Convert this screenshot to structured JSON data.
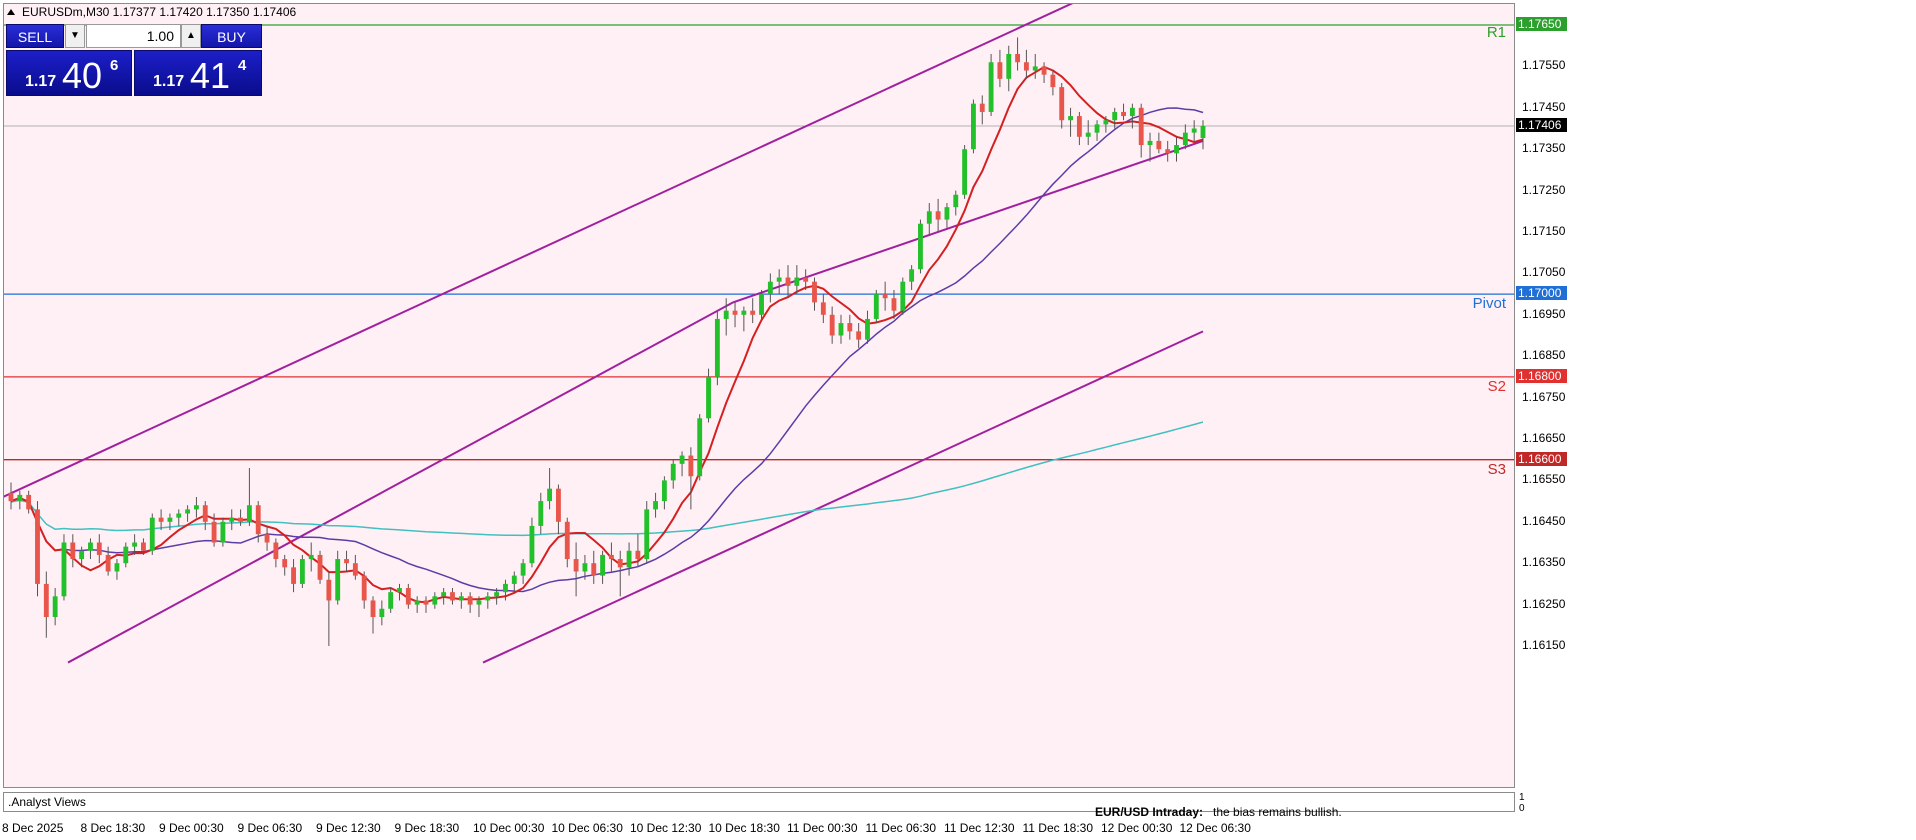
{
  "header": {
    "symbol_info": "EURUSDm,M30  1.17377 1.17420 1.17350 1.17406"
  },
  "trade_panel": {
    "sell_label": "SELL",
    "buy_label": "BUY",
    "lot_value": "1.00",
    "sell_price_small": "1.17",
    "sell_price_big": "40",
    "sell_price_sup": "6",
    "buy_price_small": "1.17",
    "buy_price_big": "41",
    "buy_price_sup": "4"
  },
  "price_axis": {
    "ticks": [
      "1.17550",
      "1.17450",
      "1.17350",
      "1.17250",
      "1.17150",
      "1.17050",
      "1.16950",
      "1.16850",
      "1.16750",
      "1.16650",
      "1.16550",
      "1.16450",
      "1.16350",
      "1.16250",
      "1.16150"
    ],
    "current_price": "1.17406",
    "levels": [
      {
        "name": "R1",
        "value": "1.17650",
        "color": "#2ca02c"
      },
      {
        "name": "Pivot",
        "value": "1.17000",
        "color": "#1f6fd6"
      },
      {
        "name": "S2",
        "value": "1.16800",
        "color": "#e03030"
      },
      {
        "name": "S3",
        "value": "1.16600",
        "color": "#c02828"
      }
    ]
  },
  "time_axis": {
    "labels": [
      "8 Dec 2025",
      "8 Dec 18:30",
      "9 Dec 00:30",
      "9 Dec 06:30",
      "9 Dec 12:30",
      "9 Dec 18:30",
      "10 Dec 00:30",
      "10 Dec 06:30",
      "10 Dec 12:30",
      "10 Dec 18:30",
      "11 Dec 00:30",
      "11 Dec 06:30",
      "11 Dec 12:30",
      "11 Dec 18:30",
      "12 Dec 00:30",
      "12 Dec 06:30"
    ]
  },
  "subwindow": {
    "label": ".Analyst Views",
    "scale_top": "1",
    "scale_bottom": "0"
  },
  "analyst_view": {
    "title": "EUR/USD Intraday:",
    "text": "the bias remains bullish."
  },
  "colors": {
    "background": "#fff0f5",
    "bull_candle": "#22c02a",
    "bear_candle": "#e8554a",
    "channel": "#a020a0",
    "ma_fast": "#d42020",
    "ma_mid": "#5a3ea8",
    "ma_slow": "#40c0c0"
  },
  "chart_data": {
    "type": "candlestick",
    "symbol": "EURUSDm",
    "timeframe": "M30",
    "ylim": [
      1.1611,
      1.1771
    ],
    "last": {
      "open": 1.17377,
      "high": 1.1742,
      "low": 1.1735,
      "close": 1.17406
    },
    "candles": [
      [
        1.1652,
        1.16545,
        1.1648,
        1.165
      ],
      [
        1.165,
        1.16525,
        1.1648,
        1.16515
      ],
      [
        1.16515,
        1.16525,
        1.1647,
        1.1648
      ],
      [
        1.1648,
        1.165,
        1.1627,
        1.163
      ],
      [
        1.163,
        1.1633,
        1.1617,
        1.1622
      ],
      [
        1.1622,
        1.1629,
        1.162,
        1.1627
      ],
      [
        1.1627,
        1.1642,
        1.1626,
        1.164
      ],
      [
        1.164,
        1.1642,
        1.1634,
        1.1636
      ],
      [
        1.1636,
        1.1639,
        1.1634,
        1.1638
      ],
      [
        1.1638,
        1.1641,
        1.1636,
        1.164
      ],
      [
        1.164,
        1.1642,
        1.1635,
        1.1637
      ],
      [
        1.1637,
        1.1639,
        1.1632,
        1.1633
      ],
      [
        1.1633,
        1.1636,
        1.1631,
        1.1635
      ],
      [
        1.1635,
        1.164,
        1.1634,
        1.1639
      ],
      [
        1.1639,
        1.1642,
        1.1637,
        1.164
      ],
      [
        1.164,
        1.1641,
        1.1637,
        1.1638
      ],
      [
        1.1638,
        1.1647,
        1.1637,
        1.1646
      ],
      [
        1.1646,
        1.1648,
        1.1643,
        1.1645
      ],
      [
        1.1645,
        1.1647,
        1.1643,
        1.1646
      ],
      [
        1.1646,
        1.1648,
        1.1644,
        1.1647
      ],
      [
        1.1647,
        1.1649,
        1.1645,
        1.1648
      ],
      [
        1.1648,
        1.1651,
        1.1646,
        1.1649
      ],
      [
        1.1649,
        1.165,
        1.1643,
        1.1645
      ],
      [
        1.1645,
        1.1647,
        1.1639,
        1.164
      ],
      [
        1.164,
        1.1646,
        1.1639,
        1.1645
      ],
      [
        1.1645,
        1.1648,
        1.1643,
        1.1646
      ],
      [
        1.1646,
        1.1648,
        1.1644,
        1.1645
      ],
      [
        1.1645,
        1.1658,
        1.1644,
        1.1649
      ],
      [
        1.1649,
        1.165,
        1.164,
        1.1642
      ],
      [
        1.1642,
        1.1644,
        1.1638,
        1.164
      ],
      [
        1.164,
        1.1641,
        1.1634,
        1.1636
      ],
      [
        1.1636,
        1.1637,
        1.1632,
        1.1634
      ],
      [
        1.1634,
        1.1636,
        1.1628,
        1.163
      ],
      [
        1.163,
        1.1637,
        1.1629,
        1.1636
      ],
      [
        1.1636,
        1.164,
        1.1633,
        1.1637
      ],
      [
        1.1637,
        1.1638,
        1.163,
        1.1631
      ],
      [
        1.1631,
        1.1633,
        1.1615,
        1.1626
      ],
      [
        1.1626,
        1.1638,
        1.1625,
        1.1636
      ],
      [
        1.1636,
        1.1638,
        1.1633,
        1.1635
      ],
      [
        1.1635,
        1.1637,
        1.1631,
        1.1632
      ],
      [
        1.1632,
        1.1633,
        1.1624,
        1.1626
      ],
      [
        1.1626,
        1.1627,
        1.1618,
        1.1622
      ],
      [
        1.1622,
        1.1626,
        1.162,
        1.1624
      ],
      [
        1.1624,
        1.1629,
        1.1623,
        1.1628
      ],
      [
        1.1628,
        1.163,
        1.1626,
        1.1629
      ],
      [
        1.1629,
        1.163,
        1.1624,
        1.1625
      ],
      [
        1.1625,
        1.1627,
        1.1623,
        1.1626
      ],
      [
        1.1626,
        1.1627,
        1.1623,
        1.1625
      ],
      [
        1.1625,
        1.1628,
        1.1624,
        1.1627
      ],
      [
        1.1627,
        1.1629,
        1.1625,
        1.1628
      ],
      [
        1.1628,
        1.1629,
        1.1625,
        1.1626
      ],
      [
        1.1626,
        1.1628,
        1.1624,
        1.1627
      ],
      [
        1.1627,
        1.1628,
        1.1623,
        1.1625
      ],
      [
        1.1625,
        1.1627,
        1.1622,
        1.1626
      ],
      [
        1.1626,
        1.1628,
        1.1624,
        1.1627
      ],
      [
        1.1627,
        1.1629,
        1.1625,
        1.1628
      ],
      [
        1.1628,
        1.1631,
        1.1626,
        1.163
      ],
      [
        1.163,
        1.1633,
        1.1628,
        1.1632
      ],
      [
        1.1632,
        1.1636,
        1.163,
        1.1635
      ],
      [
        1.1635,
        1.1646,
        1.1634,
        1.1644
      ],
      [
        1.1644,
        1.1652,
        1.1642,
        1.165
      ],
      [
        1.165,
        1.1658,
        1.1648,
        1.1653
      ],
      [
        1.1653,
        1.1654,
        1.1642,
        1.1645
      ],
      [
        1.1645,
        1.1646,
        1.1634,
        1.1636
      ],
      [
        1.1636,
        1.164,
        1.1627,
        1.1633
      ],
      [
        1.1633,
        1.1637,
        1.1631,
        1.1635
      ],
      [
        1.1635,
        1.1638,
        1.163,
        1.1632
      ],
      [
        1.1632,
        1.1638,
        1.163,
        1.1637
      ],
      [
        1.1637,
        1.164,
        1.1633,
        1.1636
      ],
      [
        1.1636,
        1.1638,
        1.1627,
        1.1634
      ],
      [
        1.1634,
        1.164,
        1.1632,
        1.1638
      ],
      [
        1.1638,
        1.1642,
        1.1634,
        1.1636
      ],
      [
        1.1636,
        1.165,
        1.1635,
        1.1648
      ],
      [
        1.1648,
        1.1652,
        1.1646,
        1.165
      ],
      [
        1.165,
        1.1656,
        1.1648,
        1.1655
      ],
      [
        1.1655,
        1.166,
        1.1653,
        1.1659
      ],
      [
        1.1659,
        1.1662,
        1.1656,
        1.1661
      ],
      [
        1.1661,
        1.1663,
        1.1648,
        1.1656
      ],
      [
        1.1656,
        1.1671,
        1.1655,
        1.167
      ],
      [
        1.167,
        1.1682,
        1.1669,
        1.168
      ],
      [
        1.168,
        1.1696,
        1.1678,
        1.1694
      ],
      [
        1.1694,
        1.1699,
        1.169,
        1.1696
      ],
      [
        1.1696,
        1.1698,
        1.1692,
        1.1695
      ],
      [
        1.1695,
        1.1697,
        1.1691,
        1.1696
      ],
      [
        1.1696,
        1.1699,
        1.1693,
        1.1695
      ],
      [
        1.1695,
        1.1701,
        1.1694,
        1.17
      ],
      [
        1.17,
        1.1705,
        1.1698,
        1.1703
      ],
      [
        1.1703,
        1.1706,
        1.17,
        1.1704
      ],
      [
        1.1704,
        1.1707,
        1.1699,
        1.1702
      ],
      [
        1.1702,
        1.1707,
        1.17,
        1.1704
      ],
      [
        1.1704,
        1.1706,
        1.1701,
        1.1703
      ],
      [
        1.1703,
        1.1704,
        1.1696,
        1.1698
      ],
      [
        1.1698,
        1.17,
        1.1693,
        1.1695
      ],
      [
        1.1695,
        1.1697,
        1.1688,
        1.169
      ],
      [
        1.169,
        1.1695,
        1.1688,
        1.1693
      ],
      [
        1.1693,
        1.1695,
        1.1689,
        1.1691
      ],
      [
        1.1691,
        1.1693,
        1.1687,
        1.1689
      ],
      [
        1.1689,
        1.1696,
        1.1688,
        1.1694
      ],
      [
        1.1694,
        1.1701,
        1.1693,
        1.17
      ],
      [
        1.17,
        1.1703,
        1.1696,
        1.1699
      ],
      [
        1.1699,
        1.1701,
        1.1694,
        1.1696
      ],
      [
        1.1696,
        1.1704,
        1.1695,
        1.1703
      ],
      [
        1.1703,
        1.1707,
        1.1701,
        1.1706
      ],
      [
        1.1706,
        1.1718,
        1.1705,
        1.1717
      ],
      [
        1.1717,
        1.1722,
        1.1714,
        1.172
      ],
      [
        1.172,
        1.1723,
        1.1715,
        1.1718
      ],
      [
        1.1718,
        1.1722,
        1.1716,
        1.1721
      ],
      [
        1.1721,
        1.1725,
        1.1719,
        1.1724
      ],
      [
        1.1724,
        1.1736,
        1.1723,
        1.1735
      ],
      [
        1.1735,
        1.1747,
        1.1734,
        1.1746
      ],
      [
        1.1746,
        1.1748,
        1.1741,
        1.1744
      ],
      [
        1.1744,
        1.1758,
        1.1743,
        1.1756
      ],
      [
        1.1756,
        1.1759,
        1.175,
        1.1752
      ],
      [
        1.1752,
        1.176,
        1.1749,
        1.1758
      ],
      [
        1.1758,
        1.1762,
        1.1754,
        1.1756
      ],
      [
        1.1756,
        1.1759,
        1.1752,
        1.1754
      ],
      [
        1.1754,
        1.1758,
        1.1752,
        1.1755
      ],
      [
        1.1755,
        1.1756,
        1.1751,
        1.1753
      ],
      [
        1.1753,
        1.1754,
        1.1748,
        1.175
      ],
      [
        1.175,
        1.1751,
        1.174,
        1.1742
      ],
      [
        1.1742,
        1.1745,
        1.1738,
        1.1743
      ],
      [
        1.1743,
        1.1744,
        1.1736,
        1.1738
      ],
      [
        1.1738,
        1.1742,
        1.1736,
        1.1739
      ],
      [
        1.1739,
        1.1742,
        1.1737,
        1.1741
      ],
      [
        1.1741,
        1.1743,
        1.1739,
        1.1742
      ],
      [
        1.1742,
        1.1745,
        1.174,
        1.1744
      ],
      [
        1.1744,
        1.1746,
        1.1742,
        1.1743
      ],
      [
        1.1743,
        1.1746,
        1.174,
        1.1745
      ],
      [
        1.1745,
        1.1746,
        1.1733,
        1.1736
      ],
      [
        1.1736,
        1.1739,
        1.1732,
        1.1737
      ],
      [
        1.1737,
        1.1739,
        1.1734,
        1.1735
      ],
      [
        1.1735,
        1.1737,
        1.1732,
        1.1734
      ],
      [
        1.1734,
        1.1738,
        1.1732,
        1.1736
      ],
      [
        1.1736,
        1.1741,
        1.1735,
        1.1739
      ],
      [
        1.1739,
        1.1742,
        1.1737,
        1.174
      ],
      [
        1.17377,
        1.1742,
        1.1735,
        1.17406
      ]
    ]
  }
}
